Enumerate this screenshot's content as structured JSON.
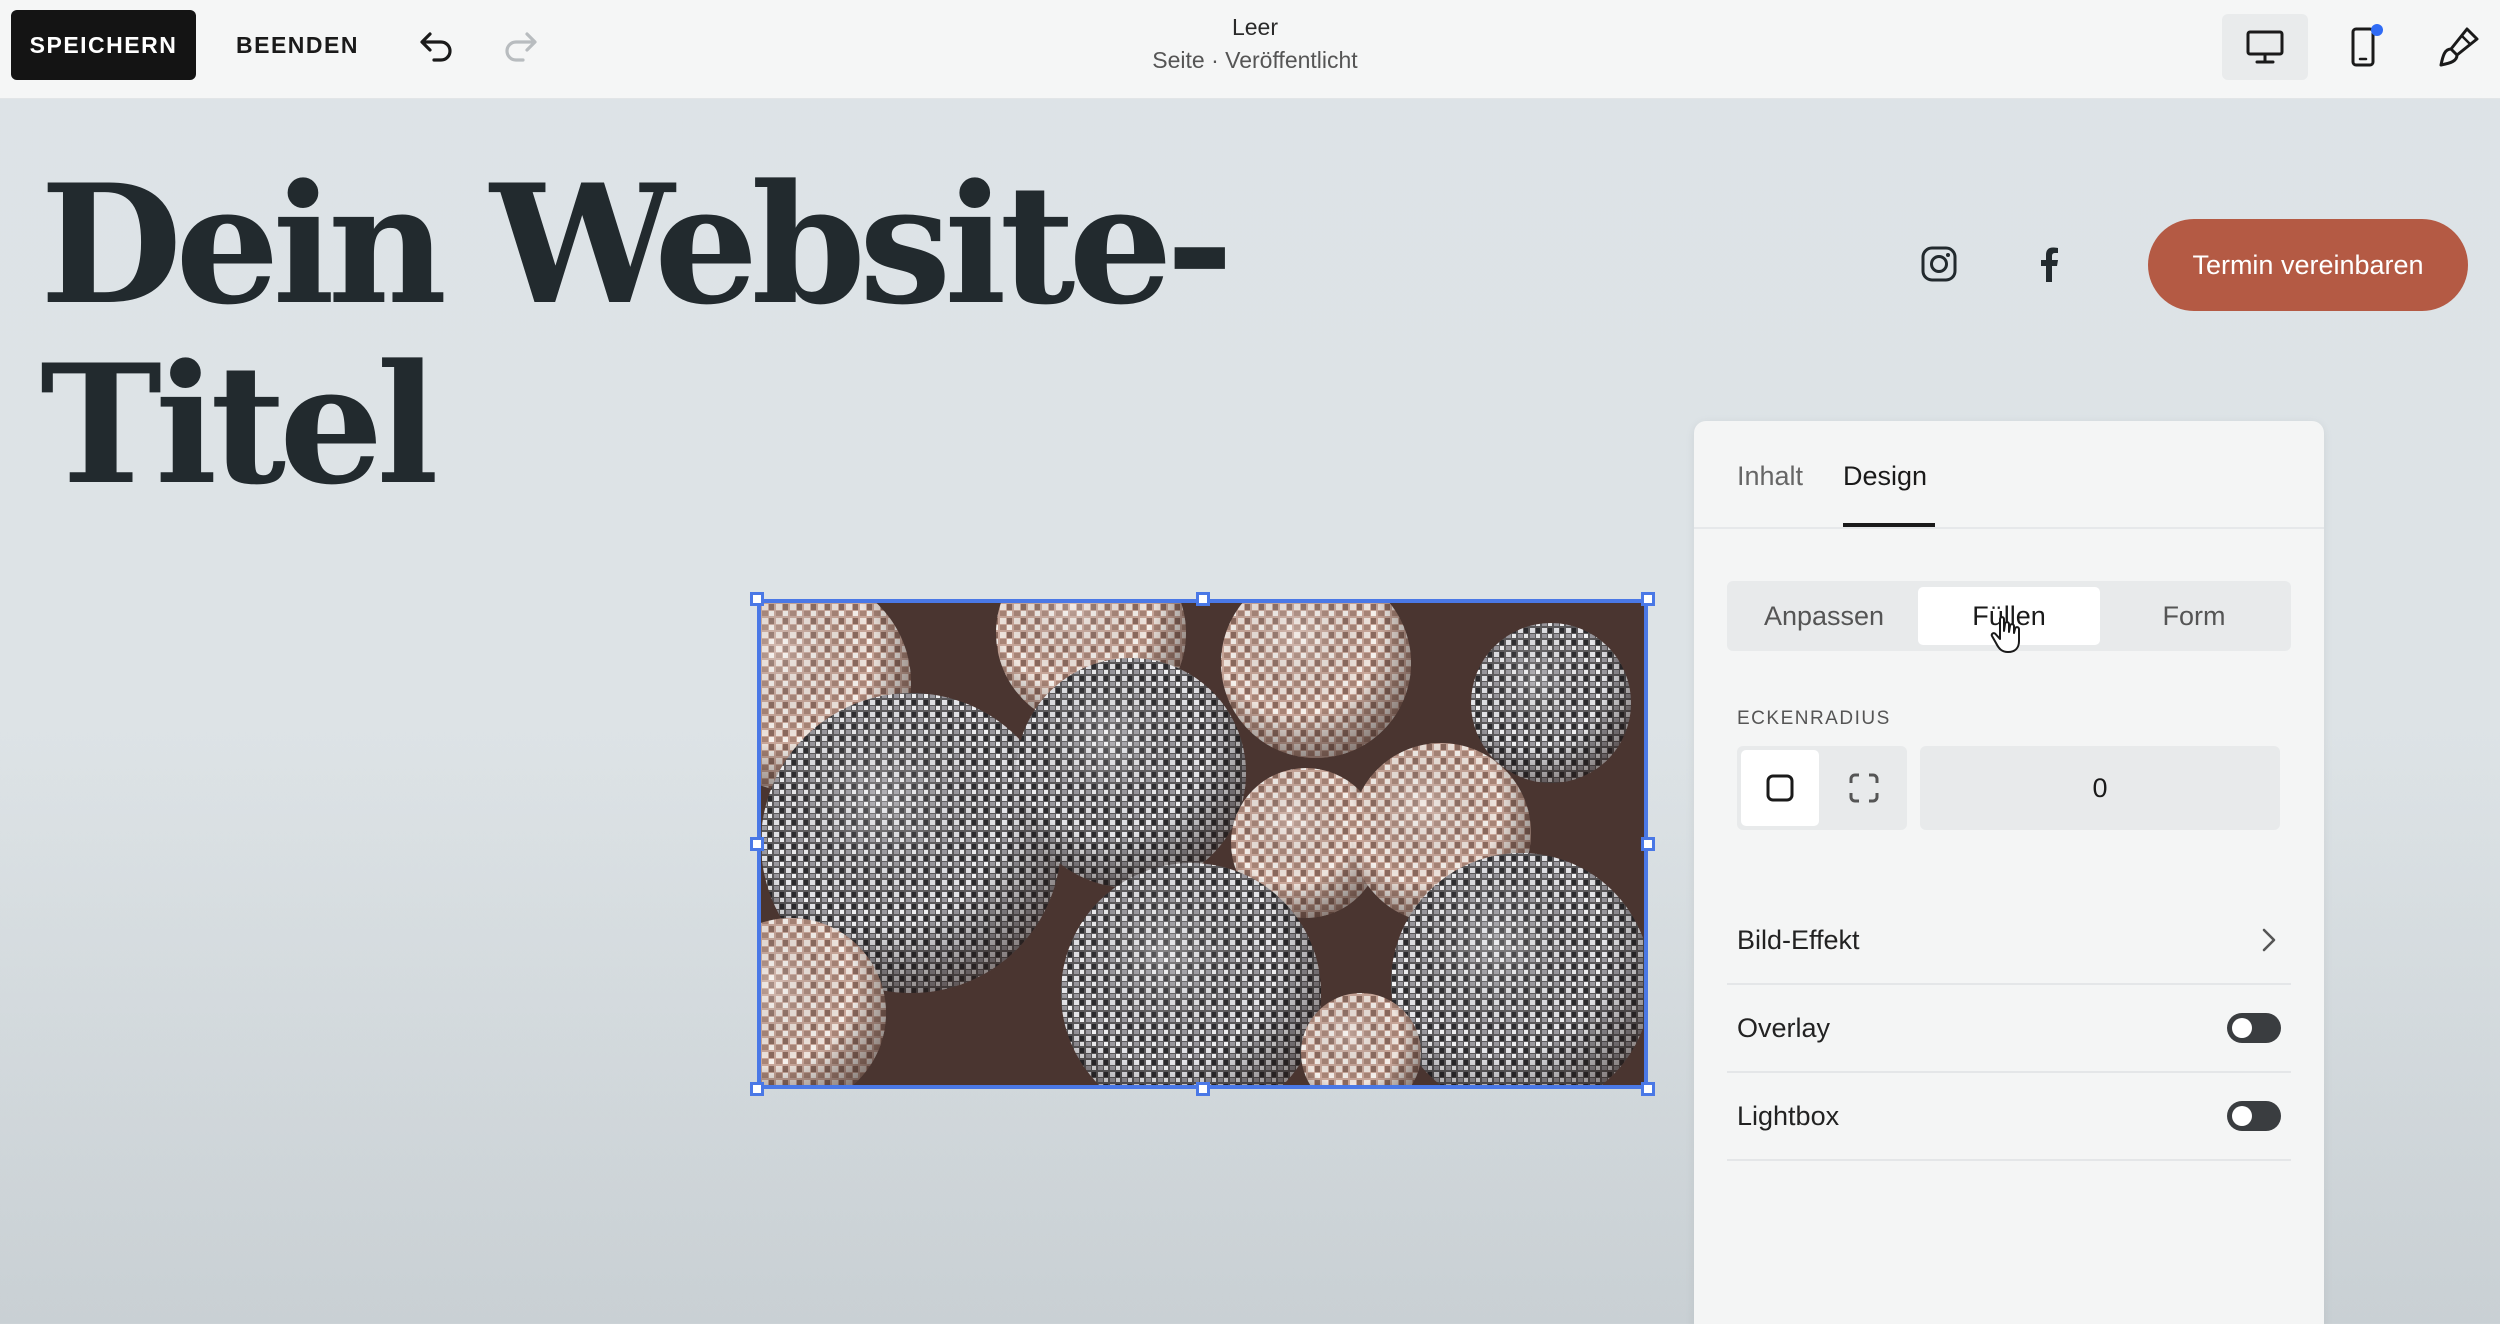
{
  "toolbar": {
    "save_label": "SPEICHERN",
    "exit_label": "BEENDEN",
    "page_title": "Leer",
    "page_status": "Seite · Veröffentlicht",
    "icons": [
      "undo-icon",
      "redo-icon",
      "desktop-icon",
      "mobile-icon",
      "paintbrush-icon"
    ],
    "notification_dot_color": "#2f6bf5"
  },
  "site": {
    "title": "Dein Website-Titel",
    "cta_label": "Termin vereinbaren",
    "cta_color": "#b45a44",
    "social_icons": [
      "instagram-icon",
      "facebook-icon"
    ]
  },
  "image": {
    "selection_color": "#4a78e6",
    "subject": "disco-balls-photo"
  },
  "panel": {
    "tabs": [
      {
        "label": "Inhalt",
        "active": false
      },
      {
        "label": "Design",
        "active": true
      }
    ],
    "segments": [
      {
        "label": "Anpassen",
        "active": false
      },
      {
        "label": "Füllen",
        "active": true
      },
      {
        "label": "Form",
        "active": false
      }
    ],
    "corner_radius_label": "ECKENRADIUS",
    "corner_radius_value": "0",
    "rows": {
      "bild_effekt": "Bild-Effekt",
      "overlay": "Overlay",
      "lightbox": "Lightbox"
    },
    "toggles": {
      "overlay": false,
      "lightbox": false
    }
  }
}
